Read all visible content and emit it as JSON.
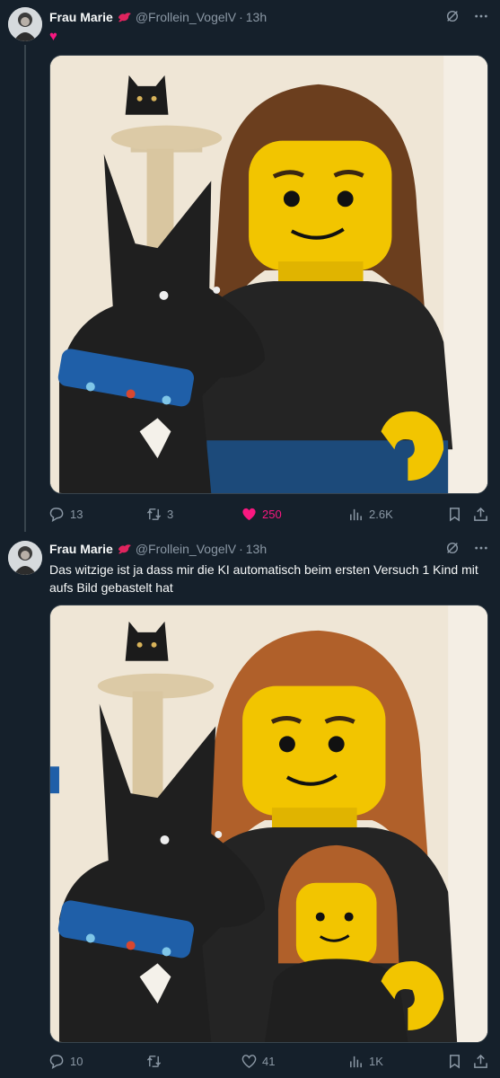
{
  "tweets": [
    {
      "author_name": "Frau Marie",
      "handle": "@Frollein_VogelV",
      "separator": "·",
      "time": "13h",
      "heart": "♥",
      "actions": {
        "replies": "13",
        "retweets": "3",
        "likes": "250",
        "views": "2.6K"
      },
      "liked": true
    },
    {
      "author_name": "Frau Marie",
      "handle": "@Frollein_VogelV",
      "separator": "·",
      "time": "13h",
      "text": "Das witzige ist ja dass mir die KI automatisch beim ersten Versuch 1 Kind mit aufs Bild gebastelt hat",
      "actions": {
        "replies": "10",
        "retweets": "",
        "likes": "41",
        "views": "1K"
      },
      "liked": false
    }
  ],
  "colors": {
    "background": "#15202b",
    "like_pink": "#f91880",
    "muted": "#8b98a5",
    "badge_red": "#e0245e"
  },
  "icons": [
    "grok-icon",
    "more-icon",
    "reply-icon",
    "retweet-icon",
    "like-icon",
    "views-icon",
    "bookmark-icon",
    "share-icon",
    "bird-badge-icon"
  ]
}
